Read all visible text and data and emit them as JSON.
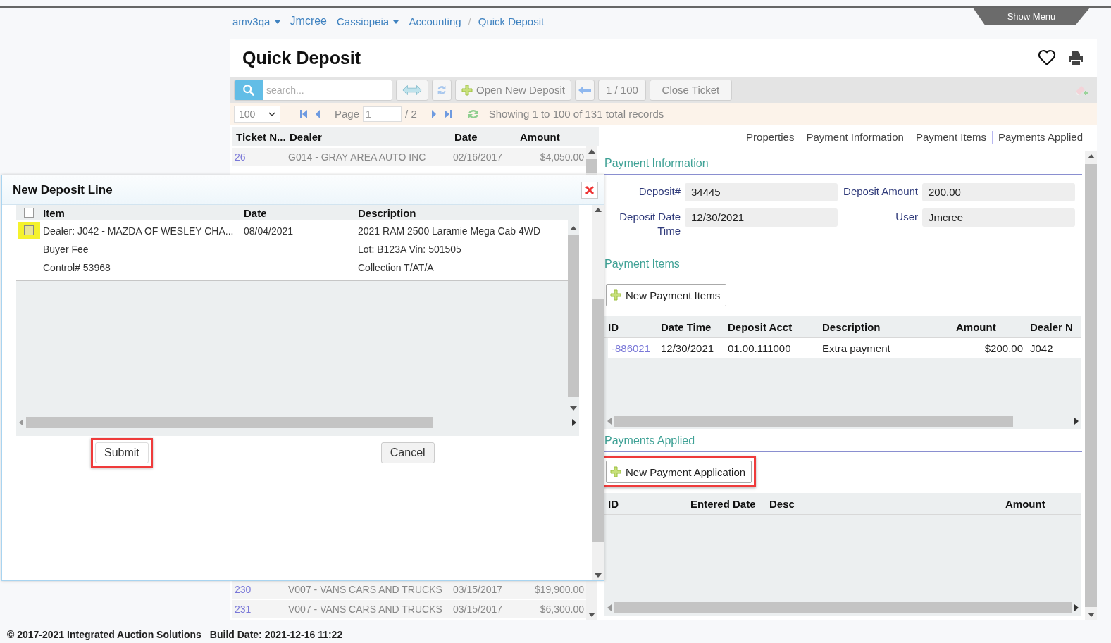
{
  "breadcrumb": [
    {
      "kind": "menu",
      "label": "amv3qa"
    },
    {
      "kind": "link",
      "label": "Jmcree"
    },
    {
      "kind": "menu",
      "label": "Cassiopeia"
    },
    {
      "kind": "link",
      "label": "Accounting"
    },
    {
      "kind": "separator",
      "label": "/"
    },
    {
      "kind": "link",
      "label": "Quick Deposit"
    }
  ],
  "show_menu": "Show Menu",
  "title": "Quick Deposit",
  "toolbar": {
    "search_placeholder": "search...",
    "open_new_deposit": "Open New Deposit",
    "counter": "1 / 100",
    "close_ticket": "Close Ticket"
  },
  "pager": {
    "page_size": "100",
    "page_label": "Page",
    "page": "1",
    "page_total": "/ 2",
    "status": "Showing 1 to 100 of 131 total records"
  },
  "ticket_grid": {
    "columns": [
      "Ticket N...",
      "Dealer",
      "Date",
      "Amount"
    ],
    "rows": [
      {
        "cells": [
          "26",
          "G014 - GRAY AREA AUTO INC",
          "02/16/2017",
          "$4,050.00"
        ]
      },
      {
        "cells": [
          "230",
          "V007 - VANS CARS AND TRUCKS",
          "03/15/2017",
          "$19,900.00"
        ]
      },
      {
        "cells": [
          "231",
          "V007 - VANS CARS AND TRUCKS",
          "03/15/2017",
          "$6,300.00"
        ]
      }
    ]
  },
  "detail_tabs": [
    "Properties",
    "Payment Information",
    "Payment Items",
    "Payments Applied"
  ],
  "payment_information": {
    "heading": "Payment Information",
    "fields": [
      {
        "label": "Deposit#",
        "value": "34445"
      },
      {
        "label": "Deposit Amount",
        "value": "200.00"
      },
      {
        "label": "Deposit Date Time",
        "value": "12/30/2021"
      },
      {
        "label": "User",
        "value": "Jmcree"
      }
    ]
  },
  "payment_items": {
    "heading": "Payment Items",
    "button": {
      "label": "New Payment Items",
      "highlighted": false
    },
    "columns": [
      "ID",
      "Date Time",
      "Deposit Acct",
      "Description",
      "Amount",
      "Dealer N"
    ],
    "rows": [
      {
        "cells": [
          "-886021",
          "12/30/2021",
          "01.00.111000",
          "Extra payment",
          "$200.00",
          "J042"
        ]
      }
    ]
  },
  "payments_applied": {
    "heading": "Payments Applied",
    "button": {
      "label": "New Payment Application",
      "highlighted": true
    },
    "columns": [
      "ID",
      "Entered Date",
      "Desc",
      "Amount"
    ]
  },
  "dialog": {
    "title": "New Deposit Line",
    "columns": [
      "Item",
      "Date",
      "Description"
    ],
    "select_all_checked": false,
    "rows": [
      {
        "checked": false,
        "highlighted": true,
        "item_lines": [
          "Dealer: J042 - MAZDA OF WESLEY CHA...",
          "Buyer Fee",
          "Control# 53968"
        ],
        "date": "08/04/2021",
        "description_lines": [
          "2021 RAM 2500 Laramie Mega Cab 4WD",
          "Lot: B123A Vin: 501505",
          "Collection T/AT/A"
        ]
      }
    ],
    "buttons": [
      {
        "label": "Submit",
        "highlighted": true
      },
      {
        "label": "Cancel",
        "highlighted": false
      }
    ]
  },
  "footer": [
    "© 2017-2021 Integrated Auction Solutions",
    "Build Date: 2021-12-16 11:22"
  ]
}
